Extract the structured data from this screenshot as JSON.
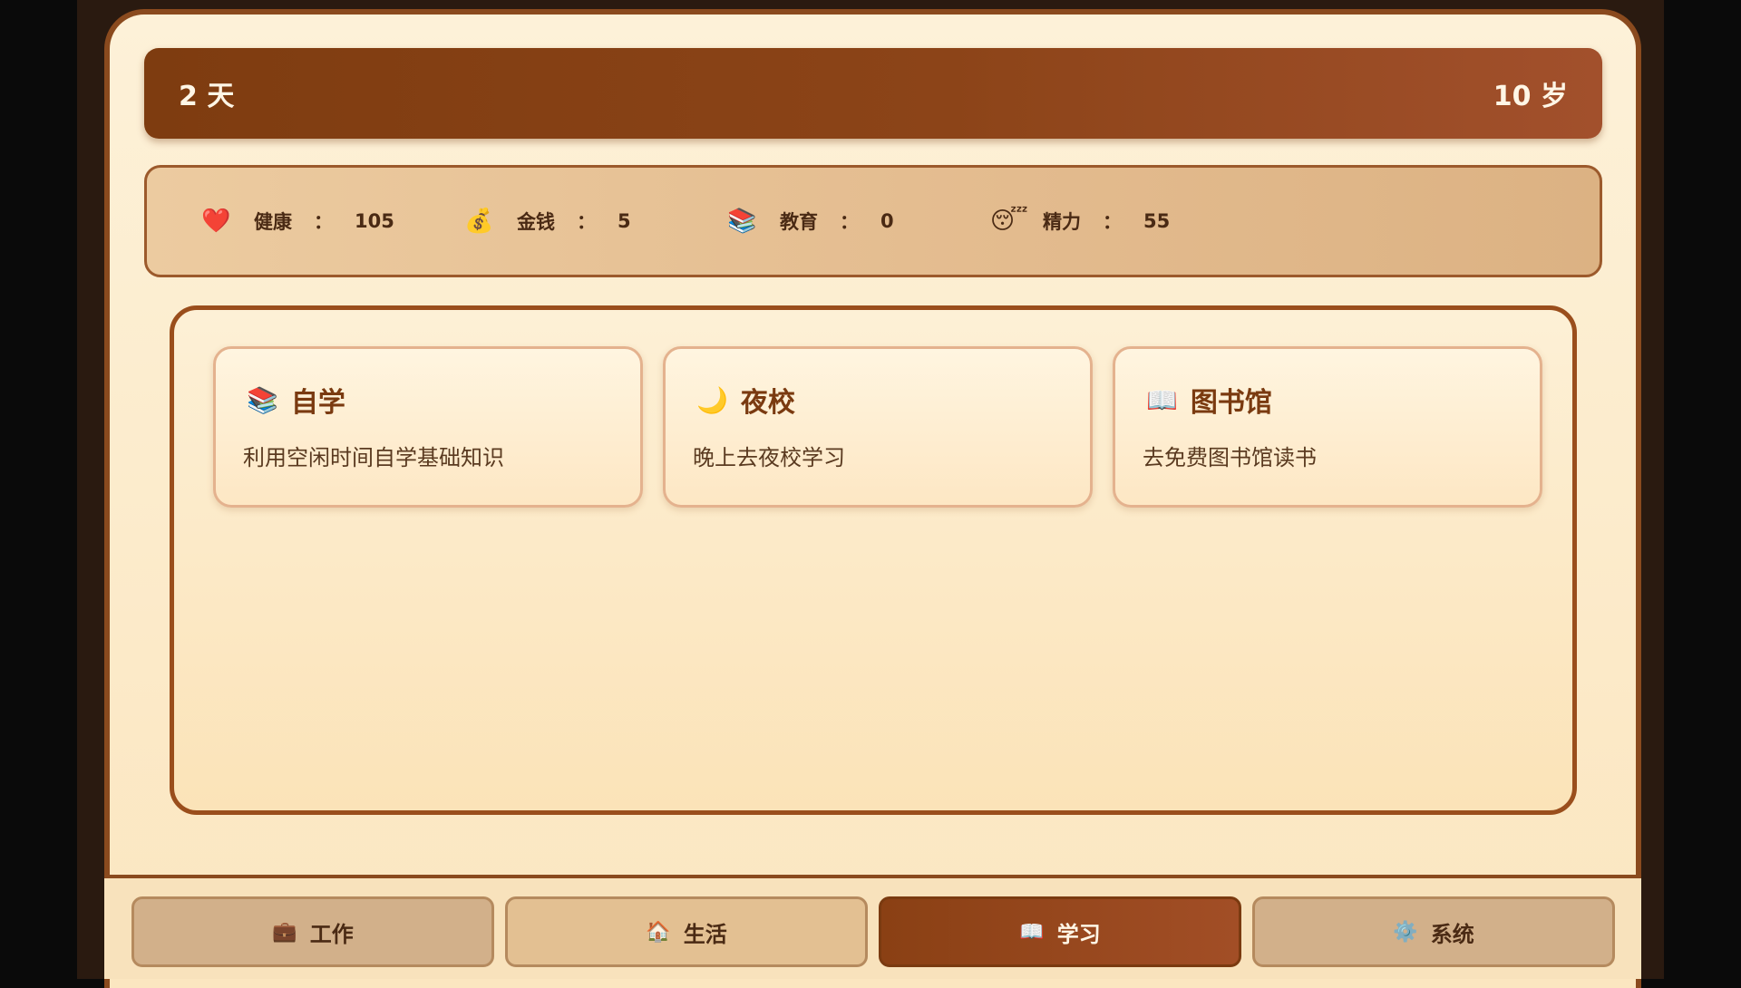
{
  "header": {
    "day": "2 天",
    "age": "10 岁"
  },
  "stats": [
    {
      "icon": "❤️",
      "label": "健康",
      "colon": "：",
      "value": "105"
    },
    {
      "icon": "💰",
      "label": "金钱",
      "colon": "：",
      "value": "5"
    },
    {
      "icon": "📚",
      "label": "教育",
      "colon": "：",
      "value": "0"
    },
    {
      "icon": "😴",
      "label": "精力",
      "colon": "：",
      "value": "55"
    }
  ],
  "actions": [
    {
      "icon": "📚",
      "title": "自学",
      "desc": "利用空闲时间自学基础知识"
    },
    {
      "icon": "🌙",
      "title": "夜校",
      "desc": "晚上去夜校学习"
    },
    {
      "icon": "📖",
      "title": "图书馆",
      "desc": "去免费图书馆读书"
    }
  ],
  "tabs": [
    {
      "icon": "💼",
      "label": "工作"
    },
    {
      "icon": "🏠",
      "label": "生活"
    },
    {
      "icon": "📖",
      "label": "学习"
    },
    {
      "icon": "⚙️",
      "label": "系统"
    }
  ],
  "active_tab": "学习",
  "colors": {
    "accent": "#8a4014",
    "panel": "#fdf1d8",
    "border": "#8a4a1e"
  }
}
